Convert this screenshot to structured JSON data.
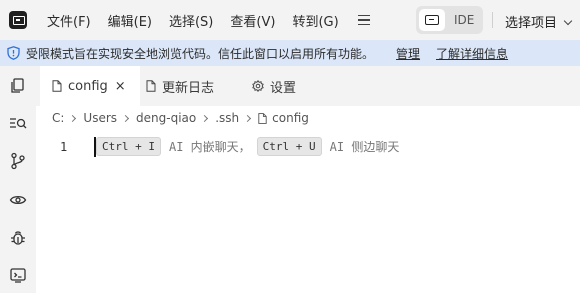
{
  "menu": [
    "文件(F)",
    "编辑(E)",
    "选择(S)",
    "查看(V)",
    "转到(G)"
  ],
  "ide_toggle": {
    "label": "IDE"
  },
  "project_select": {
    "label": "选择项目"
  },
  "banner": {
    "message": "受限模式旨在实现安全地浏览代码。信任此窗口以启用所有功能。",
    "manage_link": "管理",
    "learn_link": "了解详细信息",
    "background": "#dbe7f8"
  },
  "tabs": [
    {
      "label": "config",
      "icon": "file-icon",
      "active": true,
      "close": "×"
    },
    {
      "label": "更新日志",
      "icon": "file-icon",
      "active": false
    },
    {
      "label": "设置",
      "icon": "gear-icon",
      "active": false
    }
  ],
  "breadcrumb": [
    "C:",
    "Users",
    "deng-qiao",
    ".ssh",
    "config"
  ],
  "editor": {
    "line_number": "1",
    "hint_key1": "Ctrl + I",
    "hint_text1": "AI 内嵌聊天，",
    "hint_key2": "Ctrl + U",
    "hint_text2": "AI 侧边聊天"
  },
  "activity_icons": [
    "explorer-icon",
    "search-icon",
    "source-control-icon",
    "preview-icon",
    "debug-icon",
    "remote-icon"
  ]
}
